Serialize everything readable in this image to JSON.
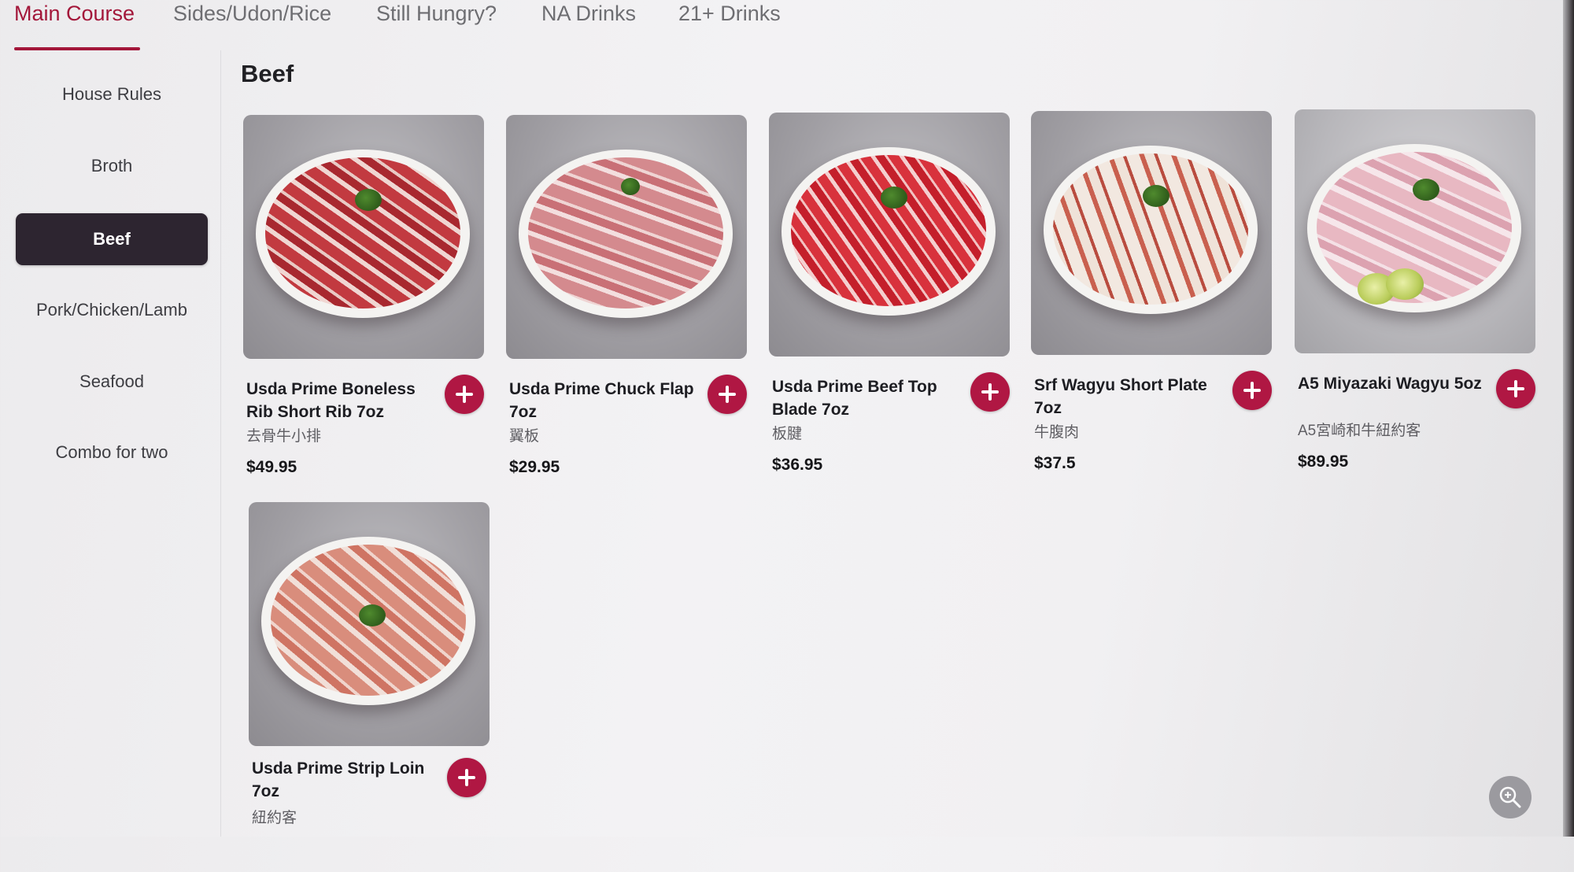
{
  "top_tabs": [
    {
      "label": "Main Course",
      "active": true
    },
    {
      "label": "Sides/Udon/Rice",
      "active": false
    },
    {
      "label": "Still Hungry?",
      "active": false
    },
    {
      "label": "NA Drinks",
      "active": false
    },
    {
      "label": "21+ Drinks",
      "active": false
    }
  ],
  "sidebar": {
    "items": [
      {
        "label": "House Rules",
        "active": false
      },
      {
        "label": "Broth",
        "active": false
      },
      {
        "label": "Beef",
        "active": true
      },
      {
        "label": "Pork/Chicken/Lamb",
        "active": false
      },
      {
        "label": "Seafood",
        "active": false
      },
      {
        "label": "Combo for two",
        "active": false
      }
    ]
  },
  "section": {
    "title": "Beef"
  },
  "items": [
    {
      "name": "Usda Prime Boneless Rib Short Rib 7oz",
      "subtitle": "去骨牛小排",
      "price": "$49.95"
    },
    {
      "name": "Usda Prime Chuck Flap 7oz",
      "subtitle": "翼板",
      "price": "$29.95"
    },
    {
      "name": "Usda Prime Beef Top Blade 7oz",
      "subtitle": "板腱",
      "price": "$36.95"
    },
    {
      "name": "Srf Wagyu Short Plate 7oz",
      "subtitle": "牛腹肉",
      "price": "$37.5"
    },
    {
      "name": "A5 Miyazaki Wagyu 5oz",
      "subtitle": "A5宮崎和牛紐約客",
      "price": "$89.95"
    },
    {
      "name": "Usda Prime Strip Loin 7oz",
      "subtitle": "紐約客",
      "price": ""
    }
  ],
  "icons": {
    "add": "plus-icon",
    "zoom": "zoom-in-icon"
  },
  "colors": {
    "accent": "#b01743",
    "active_tab": "#a3173a",
    "sidebar_active": "#2d2530"
  }
}
